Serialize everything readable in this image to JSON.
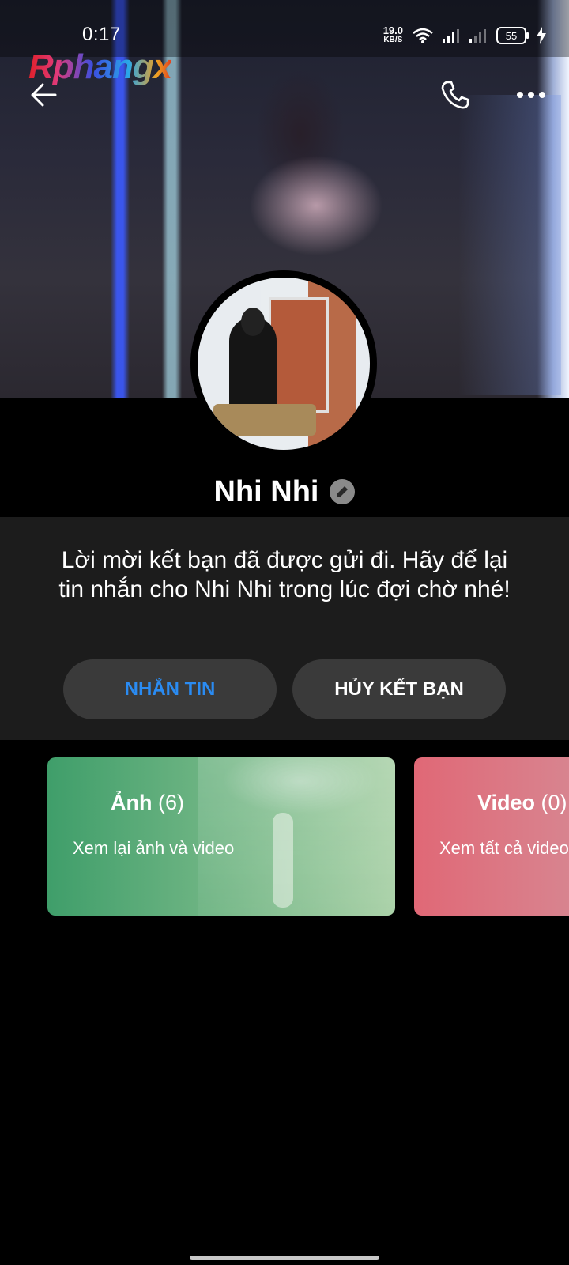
{
  "status_bar": {
    "time": "0:17",
    "net_speed": "19.0",
    "net_unit": "KB/S",
    "battery": "55"
  },
  "watermark": "Rphangx",
  "profile": {
    "name": "Nhi Nhi",
    "friend_request_message": "Lời mời kết bạn đã được gửi đi. Hãy để lại tin nhắn cho Nhi Nhi trong lúc đợi chờ nhé!"
  },
  "actions": {
    "message_label": "NHẮN TIN",
    "unfriend_label": "HỦY KẾT BẠN"
  },
  "media_cards": [
    {
      "title": "Ảnh",
      "count": "(6)",
      "subtitle": "Xem lại ảnh và video"
    },
    {
      "title": "Video",
      "count": "(0)",
      "subtitle": "Xem tất cả video"
    }
  ],
  "colors": {
    "accent_blue": "#2a8bf2",
    "panel_bg": "#1c1c1c",
    "button_bg": "#3a3a3a",
    "photos_card": "#3f9e6a",
    "video_card": "#e06876"
  },
  "icons": [
    "back-arrow-icon",
    "phone-icon",
    "more-icon",
    "edit-pencil-icon",
    "wifi-icon",
    "signal-icon",
    "battery-icon",
    "charging-icon"
  ]
}
